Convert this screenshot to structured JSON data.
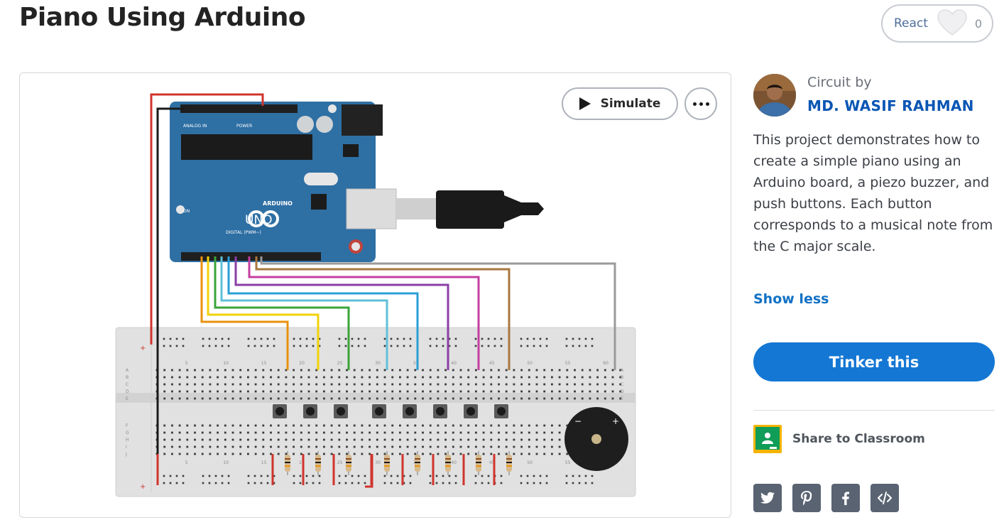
{
  "page": {
    "title": "Piano Using Arduino"
  },
  "react": {
    "label": "React",
    "count": "0"
  },
  "viewer": {
    "simulate_label": "Simulate",
    "board_labels": {
      "brand": "ARDUINO",
      "model": "UNO",
      "analog_in": "ANALOG IN",
      "power": "POWER",
      "digital": "DIGITAL (PWM~)",
      "on": "ON"
    },
    "breadboard_numbers": [
      "5",
      "10",
      "15",
      "20",
      "25",
      "30",
      "35",
      "40",
      "45",
      "50",
      "55",
      "60"
    ],
    "breadboard_rows_top": [
      "A",
      "B",
      "C",
      "D",
      "E"
    ],
    "breadboard_rows_bottom": [
      "F",
      "G",
      "H",
      "I",
      "J"
    ],
    "wire_colors": [
      "#e8920f",
      "#f2d20a",
      "#3aa43a",
      "#5fc0d8",
      "#2a9fd6",
      "#8a3fa6",
      "#c43fa0",
      "#a9773f",
      "#9a9a9a"
    ]
  },
  "author": {
    "circuit_by_label": "Circuit by",
    "name": "MD. WASIF RAHMAN"
  },
  "description": "This project demonstrates how to create a simple piano using an Arduino board, a piezo buzzer, and push buttons. Each button corresponds to a musical note from the C major scale.",
  "show_less_label": "Show less",
  "tinker_label": "Tinker this",
  "classroom": {
    "label": "Share to Classroom"
  },
  "social": [
    "twitter-icon",
    "pinterest-icon",
    "facebook-icon",
    "embed-icon"
  ],
  "colors": {
    "accent": "#1477d4",
    "author": "#0a56b4",
    "arduino_blue": "#2e6fa4",
    "breadboard": "#e0e0e0"
  }
}
